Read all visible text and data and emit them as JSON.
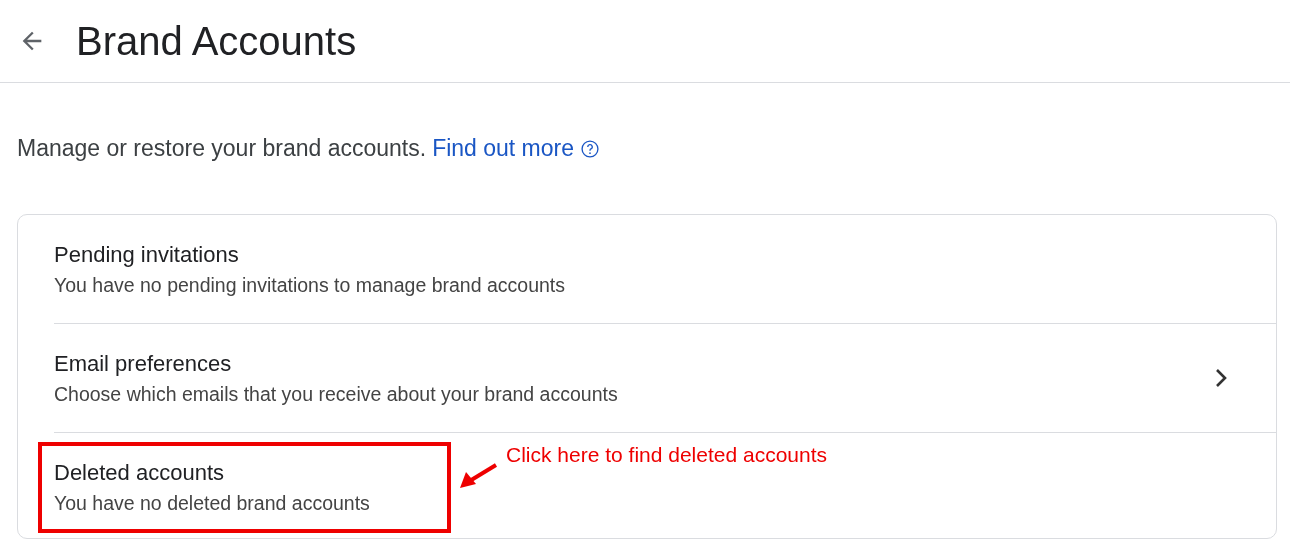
{
  "header": {
    "title": "Brand Accounts"
  },
  "intro": {
    "text": "Manage or restore your brand accounts.",
    "link": "Find out more"
  },
  "rows": [
    {
      "title": "Pending invitations",
      "subtitle": "You have no pending invitations to manage brand accounts",
      "chevron": false,
      "highlighted": false
    },
    {
      "title": "Email preferences",
      "subtitle": "Choose which emails that you receive about your brand accounts",
      "chevron": true,
      "highlighted": false
    },
    {
      "title": "Deleted accounts",
      "subtitle": "You have no deleted brand accounts",
      "chevron": false,
      "highlighted": true
    }
  ],
  "annotation": {
    "text": "Click here to find deleted accounts"
  }
}
